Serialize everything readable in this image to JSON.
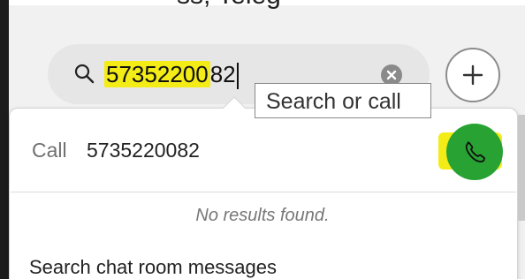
{
  "header": {
    "partial_text": "ss, Teleg"
  },
  "search": {
    "value_highlighted": "57352200",
    "value_rest": "82",
    "tooltip": "Search or call"
  },
  "results": {
    "call_label": "Call",
    "call_number": "5735220082",
    "no_results": "No results found.",
    "search_messages": "Search chat room messages"
  },
  "colors": {
    "highlight": "#f4ec17",
    "call_button": "#27a233",
    "pill_bg": "#e6e6e6"
  },
  "icons": [
    "search-icon",
    "clear-icon",
    "plus-icon",
    "phone-icon"
  ]
}
